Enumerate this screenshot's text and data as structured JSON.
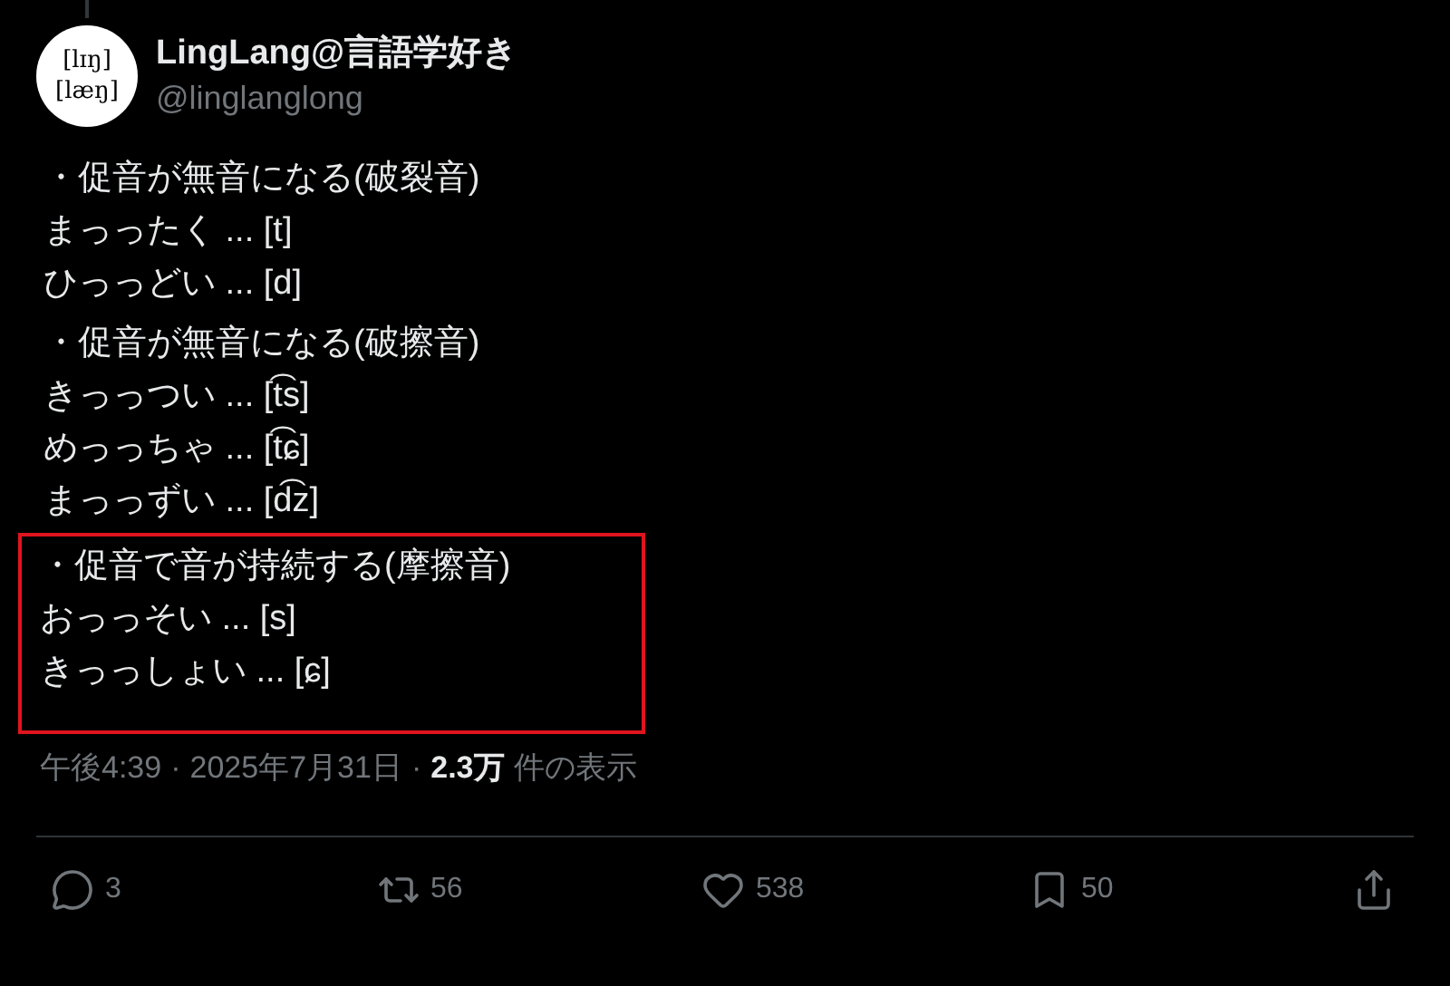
{
  "author": {
    "avatar_lines": [
      "[lɪŋ]",
      "[læŋ]"
    ],
    "name": "LingLang@言語学好き",
    "handle": "@linglanglong"
  },
  "sections": [
    {
      "heading": "・促音が無音になる(破裂音)",
      "highlighted": false,
      "lines": [
        "まっったく ... [t]",
        "ひっっどい ... [d]"
      ]
    },
    {
      "heading": "・促音が無音になる(破擦音)",
      "highlighted": false,
      "lines": [
        "きっっつい ... [t͡s]",
        "めっっちゃ ... [t͡ɕ]",
        "まっっずい ... [d͡z]"
      ]
    },
    {
      "heading": "・促音で音が持続する(摩擦音)",
      "highlighted": true,
      "lines": [
        "おっっそい ... [s]",
        "きっっしょい ... [ɕ]"
      ]
    }
  ],
  "meta": {
    "separators": [
      "·",
      "·"
    ],
    "time": "午後4:39",
    "date": "2025年7月31日",
    "views": "2.3万",
    "views_label": "件の表示"
  },
  "actions": [
    {
      "kind": "reply",
      "count": "3"
    },
    {
      "kind": "repost",
      "count": "56"
    },
    {
      "kind": "like",
      "count": "538"
    },
    {
      "kind": "bookmark",
      "count": "50"
    },
    {
      "kind": "share"
    }
  ]
}
